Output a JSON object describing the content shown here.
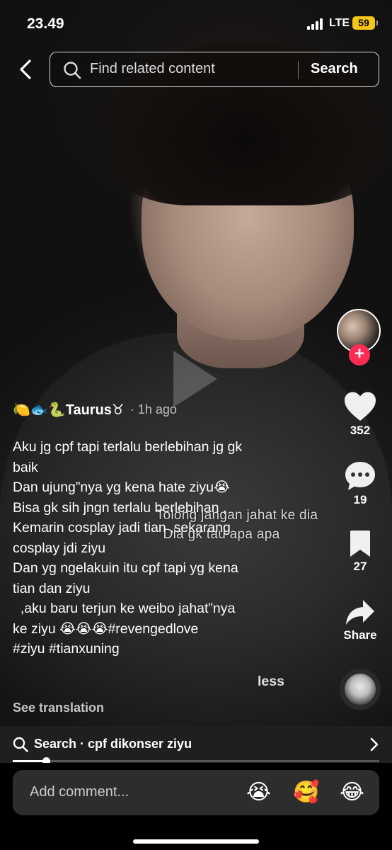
{
  "status_bar": {
    "time": "23.49",
    "network": "LTE",
    "battery": "59"
  },
  "search": {
    "placeholder": "Find related content",
    "button_label": "Search"
  },
  "video": {
    "subtitle_line1": "Tolong jangan jahat ke dia",
    "subtitle_line2": "Dia gk tau apa apa"
  },
  "rail": {
    "likes": "352",
    "comments": "19",
    "saves": "27",
    "share_label": "Share"
  },
  "post": {
    "author": "🍋🐟🐍Taurus♉",
    "time": "· 1h ago",
    "caption": "Aku jg cpf tapi terlalu berlebihan jg gk\nbaik\nDan ujung”nya yg kena hate ziyu😭\nBisa gk sih jngn terlalu berlebihan ,\nKemarin cosplay jadi tian ,sekarang\ncosplay jdi ziyu\nDan yg ngelakuin itu cpf tapi yg kena\ntian dan ziyu\n  ,aku baru terjun ke weibo jahat”nya\nke ziyu 😭😭😭#revengedlove\n#ziyu #tianxuning",
    "less_label": "less",
    "see_translation": "See translation"
  },
  "suggestion": {
    "text": "Search · cpf dikonser ziyu"
  },
  "progress": {
    "fraction": 0.09
  },
  "comment": {
    "placeholder": "Add comment...",
    "emojis": [
      "😭",
      "🥰",
      "😂"
    ]
  },
  "colors": {
    "accent": "#fe2c55",
    "battery": "#f5c518"
  }
}
